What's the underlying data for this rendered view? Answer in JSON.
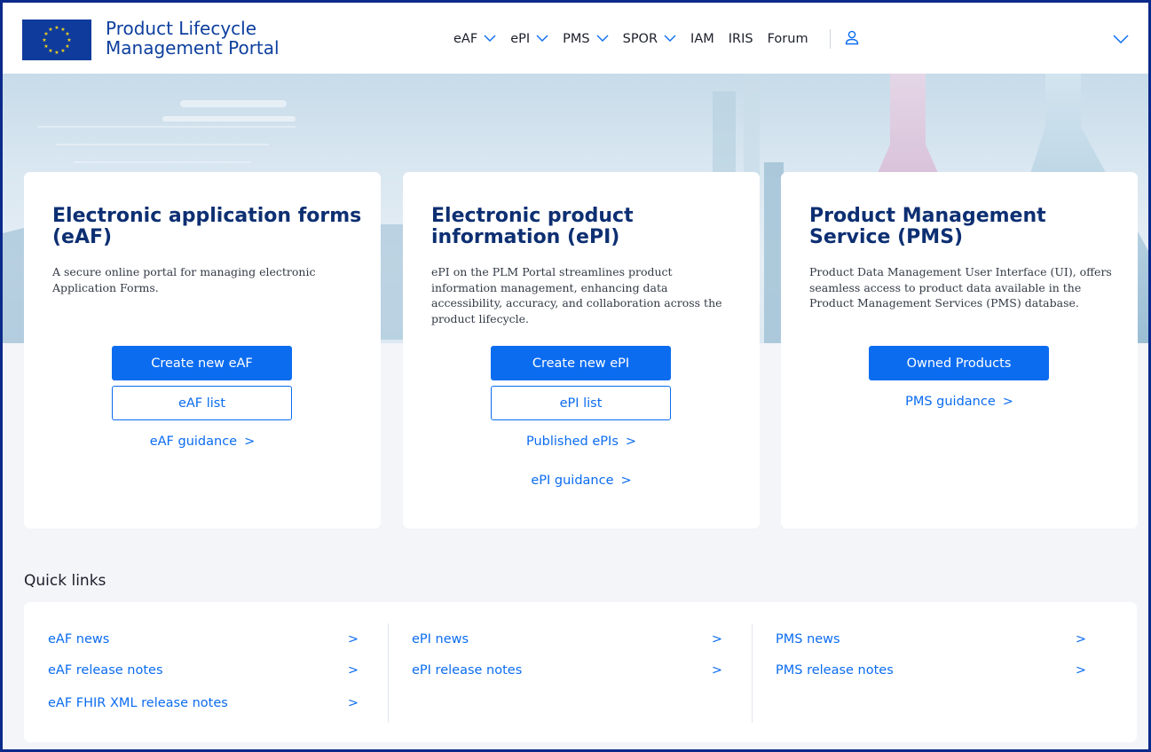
{
  "header": {
    "logo_line1": "Product Lifecycle",
    "logo_line2": "Management Portal",
    "nav": [
      {
        "label": "eAF",
        "has_dropdown": true
      },
      {
        "label": "ePI",
        "has_dropdown": true
      },
      {
        "label": "PMS",
        "has_dropdown": true
      },
      {
        "label": "SPOR",
        "has_dropdown": true
      },
      {
        "label": "IAM",
        "has_dropdown": false
      },
      {
        "label": "IRIS",
        "has_dropdown": false
      },
      {
        "label": "Forum",
        "has_dropdown": false
      }
    ],
    "user_icon": "user-icon",
    "menu_icon": "chevron-down-icon"
  },
  "cards": [
    {
      "title": "Electronic application forms (eAF)",
      "description": "A secure online portal for managing electronic Application Forms.",
      "primary_button": "Create new eAF",
      "secondary_button": "eAF list",
      "links": [
        "eAF guidance"
      ]
    },
    {
      "title": "Electronic product information (ePI)",
      "description": "ePI on the PLM Portal streamlines product information management, enhancing data accessibility, accuracy, and collaboration across the product lifecycle.",
      "primary_button": "Create new ePI",
      "secondary_button": "ePI list",
      "links": [
        "Published ePIs",
        "ePI guidance"
      ]
    },
    {
      "title": "Product Management Service (PMS)",
      "description": "Product Data Management User Interface (UI), offers seamless access to product data available in the Product Management Services (PMS) database.",
      "primary_button": "Owned Products",
      "links": [
        "PMS guidance"
      ]
    }
  ],
  "quick_links": {
    "title": "Quick links",
    "columns": [
      [
        "eAF news",
        "eAF release notes",
        "eAF FHIR XML release notes"
      ],
      [
        "ePI news",
        "ePI release notes"
      ],
      [
        "PMS news",
        "PMS release notes"
      ]
    ]
  },
  "colors": {
    "brand_blue": "#0d3f9e",
    "accent": "#0b6cf0",
    "title_navy": "#0d2f72",
    "frame_border": "#0b2a8a"
  }
}
